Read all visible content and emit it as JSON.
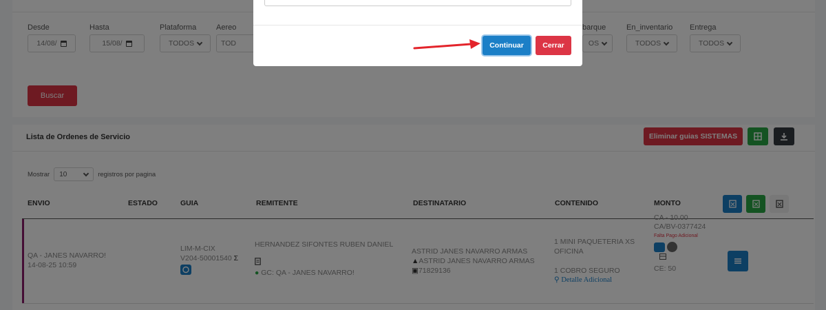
{
  "filters": {
    "desde": {
      "label": "Desde",
      "value": "14/08/"
    },
    "hasta": {
      "label": "Hasta",
      "value": "15/08/"
    },
    "plataforma": {
      "label": "Plataforma",
      "value": "TODOS"
    },
    "aereo": {
      "label": "Aereo",
      "value": "TOD"
    },
    "embarque": {
      "label": "barque",
      "value": "OS"
    },
    "en_inventario": {
      "label": "En_inventario",
      "value": "TODOS"
    },
    "entrega": {
      "label": "Entrega",
      "value": "TODOS"
    },
    "buscar_label": "Buscar"
  },
  "list": {
    "title": "Lista de Ordenes de Servicio",
    "eliminar_label": "Eliminar guias SISTEMAS",
    "mostrar_label": "Mostrar",
    "page_size": "10",
    "registros_label": "registros por pagina",
    "columns": [
      "ENVIO",
      "ESTADO",
      "GUIA",
      "REMITENTE",
      "DESTINATARIO",
      "CONTENIDO",
      "MONTO"
    ],
    "row": {
      "envio_line1": "QA - JANES NAVARRO!",
      "envio_line2": "14-08-25 10:59",
      "guia_line1": "LIM-M-CIX",
      "guia_line2": "V204-50001540",
      "guia_suffix": "Σ",
      "remitente_name": "HERNANDEZ SIFONTES RUBEN DANIEL",
      "remitente_gc": "GC: QA - JANES NAVARRO!",
      "destinatario_name": "ASTRID JANES NAVARRO ARMAS",
      "destinatario_contact": "ASTRID JANES NAVARRO ARMAS",
      "destinatario_phone": "71829136",
      "contenido_line1": "1 MINI PAQUETERIA XS",
      "contenido_line2": "OFICINA",
      "contenido_line3": "1 COBRO SEGURO",
      "contenido_link": "Detalle Adicional",
      "monto_ca": "CA - 10.00",
      "monto_code": "CA/BV-0377424",
      "monto_alert": "Falta Pago Adicional",
      "monto_ce": "CE: 50"
    }
  },
  "modal": {
    "continuar_label": "Continuar",
    "cerrar_label": "Cerrar"
  },
  "colors": {
    "primary": "#1b7fc7",
    "danger": "#dc3545",
    "success": "#28a745",
    "dark": "#343a40",
    "accent_row": "#8b1a6b"
  }
}
